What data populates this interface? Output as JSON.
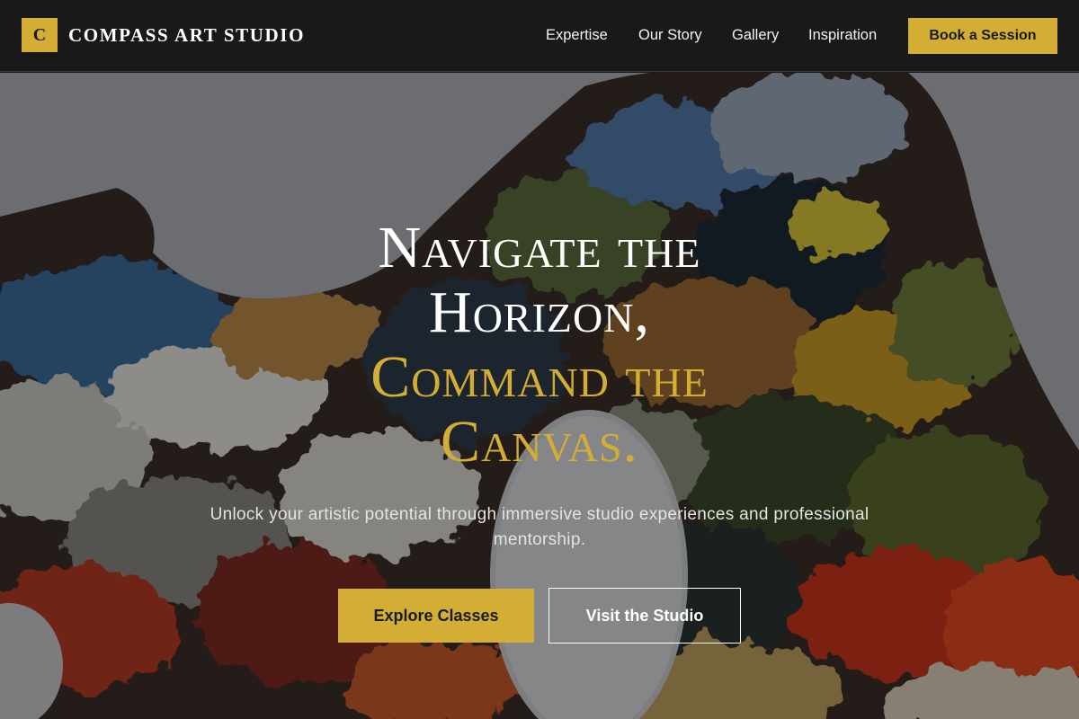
{
  "brand": {
    "logo_letter": "C",
    "name": "COMPASS ART STUDIO"
  },
  "nav": {
    "items": [
      {
        "label": "Expertise"
      },
      {
        "label": "Our Story"
      },
      {
        "label": "Gallery"
      },
      {
        "label": "Inspiration"
      }
    ],
    "cta_label": "Book a Session"
  },
  "hero": {
    "headline_line1": "Navigate the",
    "headline_line2": "Horizon,",
    "headline_line3": "Command the",
    "headline_line4": "Canvas.",
    "subtitle": "Unlock your artistic potential through immersive studio experiences and professional mentorship.",
    "primary_button": "Explore Classes",
    "secondary_button": "Visit the Studio",
    "background_image": "paint-palette-photo"
  },
  "colors": {
    "accent": "#d4ae34",
    "header_bg": "#191919",
    "text_light": "#ffffff"
  }
}
